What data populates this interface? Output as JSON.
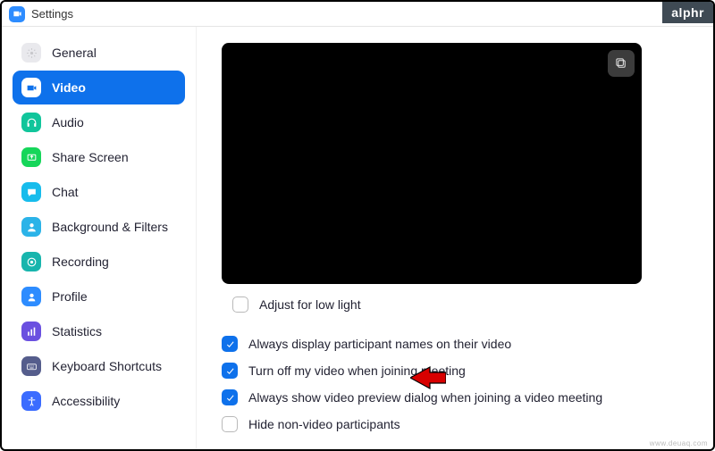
{
  "window": {
    "title": "Settings"
  },
  "watermark": "alphr",
  "sidebar": {
    "items": [
      {
        "id": "general",
        "label": "General",
        "iconbg": "#e9e9ed",
        "glyph": "gear",
        "glyphfill": "#c8c8cc"
      },
      {
        "id": "video",
        "label": "Video",
        "iconbg": "#ffffff",
        "glyph": "camera",
        "glyphfill": "#0e71eb",
        "active": true
      },
      {
        "id": "audio",
        "label": "Audio",
        "iconbg": "#11c59b",
        "glyph": "headphones",
        "glyphfill": "#ffffff"
      },
      {
        "id": "share-screen",
        "label": "Share Screen",
        "iconbg": "#16d65a",
        "glyph": "share",
        "glyphfill": "#ffffff"
      },
      {
        "id": "chat",
        "label": "Chat",
        "iconbg": "#17bcec",
        "glyph": "chat",
        "glyphfill": "#ffffff"
      },
      {
        "id": "background-filters",
        "label": "Background & Filters",
        "iconbg": "#2bb3e8",
        "glyph": "person",
        "glyphfill": "#ffffff"
      },
      {
        "id": "recording",
        "label": "Recording",
        "iconbg": "#18b5ad",
        "glyph": "record",
        "glyphfill": "#ffffff"
      },
      {
        "id": "profile",
        "label": "Profile",
        "iconbg": "#2d8cff",
        "glyph": "profile",
        "glyphfill": "#ffffff"
      },
      {
        "id": "statistics",
        "label": "Statistics",
        "iconbg": "#6a50e0",
        "glyph": "stats",
        "glyphfill": "#ffffff"
      },
      {
        "id": "keyboard-shortcuts",
        "label": "Keyboard Shortcuts",
        "iconbg": "#555d8c",
        "glyph": "keyboard",
        "glyphfill": "#ffffff"
      },
      {
        "id": "accessibility",
        "label": "Accessibility",
        "iconbg": "#3b6cff",
        "glyph": "accessibility",
        "glyphfill": "#ffffff"
      }
    ]
  },
  "main": {
    "adjust_low_light": {
      "label": "Adjust for low light",
      "checked": false
    },
    "options": [
      {
        "id": "display-names",
        "label": "Always display participant names on their video",
        "checked": true
      },
      {
        "id": "turn-off-video",
        "label": "Turn off my video when joining meeting",
        "checked": true
      },
      {
        "id": "show-preview",
        "label": "Always show video preview dialog when joining a video meeting",
        "checked": true
      },
      {
        "id": "hide-nonvideo",
        "label": "Hide non-video participants",
        "checked": false
      }
    ]
  },
  "sourcemark": "www.deuaq.com"
}
